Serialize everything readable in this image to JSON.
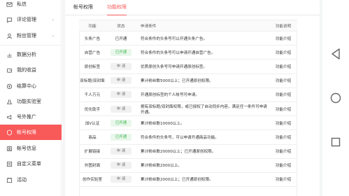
{
  "sidebar": {
    "items": [
      {
        "label": "私信",
        "icon": "mail-icon",
        "arrow": ""
      },
      {
        "label": "评论管理",
        "icon": "comment-icon",
        "arrow": "›"
      },
      {
        "label": "粉丝管理",
        "icon": "fans-icon",
        "arrow": "›"
      },
      {
        "label": "数据分析",
        "icon": "chart-icon",
        "arrow": ""
      },
      {
        "label": "我的收益",
        "icon": "wallet-icon",
        "arrow": ""
      },
      {
        "label": "结算中心",
        "icon": "settlement-icon",
        "arrow": ""
      },
      {
        "label": "功能实验室",
        "icon": "lab-icon",
        "arrow": ""
      },
      {
        "label": "号外推广",
        "icon": "promo-icon",
        "arrow": ""
      },
      {
        "label": "帐号权限",
        "icon": "shield-icon",
        "arrow": ""
      },
      {
        "label": "帐号信息",
        "icon": "user-icon",
        "arrow": ""
      },
      {
        "label": "自定义菜单",
        "icon": "menu-icon",
        "arrow": ""
      },
      {
        "label": "活动",
        "icon": "activity-icon",
        "arrow": ""
      }
    ],
    "active_index": 8
  },
  "tabs": [
    {
      "label": "帐号权限",
      "active": false
    },
    {
      "label": "功能权限",
      "active": true
    }
  ],
  "table": {
    "headers": {
      "feature": "功能",
      "status": "状态",
      "condition": "申请条件",
      "note": "功能说明"
    },
    "rows": [
      {
        "feature": "头条广告",
        "status": "已开通",
        "status_type": "text",
        "condition": "符合条件的头条号可以开通头条广告。",
        "note": "功能介绍"
      },
      {
        "feature": "自营广告",
        "status": "已开通",
        "status_type": "pill-on",
        "condition": "符合条件的头条号可以申请开通自营广告。",
        "note": "功能介绍"
      },
      {
        "feature": "原创标签",
        "status": "申 请",
        "status_type": "pill-off",
        "condition": "优质原创头条号可申请开通原创标签。",
        "note": "功能介绍"
      },
      {
        "feature": "双标题/双封面",
        "status": "申 请",
        "status_type": "pill-off",
        "condition": "累计粉丝数5000以上；已开通原创权限。",
        "note": "功能介绍"
      },
      {
        "feature": "千人万元",
        "status": "申 请",
        "status_type": "pill-off",
        "condition": "开通原创标签的个人帐号可申请。",
        "note": "功能介绍"
      },
      {
        "feature": "优化助手",
        "status": "申 请",
        "status_type": "pill-off",
        "condition": "拥有双标题/双封面权限，或已授权了自动同步内容，满足任一条件可申请开通。",
        "note": "功能介绍"
      },
      {
        "feature": "加V认证",
        "status": "已开通",
        "status_type": "pill-on",
        "condition": "累计粉丝数10000以上。",
        "note": "功能介绍"
      },
      {
        "feature": "商品",
        "status": "已开通",
        "status_type": "pill-on",
        "condition": "符合条件的头条号，可以申请开通商品功能。",
        "note": "功能介绍"
      },
      {
        "feature": "扩展链接",
        "status": "申 请",
        "status_type": "pill-off",
        "condition": "累计粉丝数20000以上；已开通原创权限。",
        "note": "功能介绍"
      },
      {
        "feature": "外图封面",
        "status": "申 请",
        "status_type": "pill-off",
        "condition": "累计粉丝数2000以上。",
        "note": "功能介绍"
      },
      {
        "feature": "创作实验室",
        "status": "申 请",
        "status_type": "pill-off",
        "condition": "累计粉丝数2000以上；已开通原创权限。",
        "note": "功能介绍"
      }
    ]
  },
  "colors": {
    "accent": "#f85959",
    "enabled": "#3ab54a",
    "link": "#3b7bd6"
  },
  "navbar": {
    "icons": [
      "back-triangle-icon",
      "home-circle-icon",
      "recents-square-icon"
    ]
  }
}
